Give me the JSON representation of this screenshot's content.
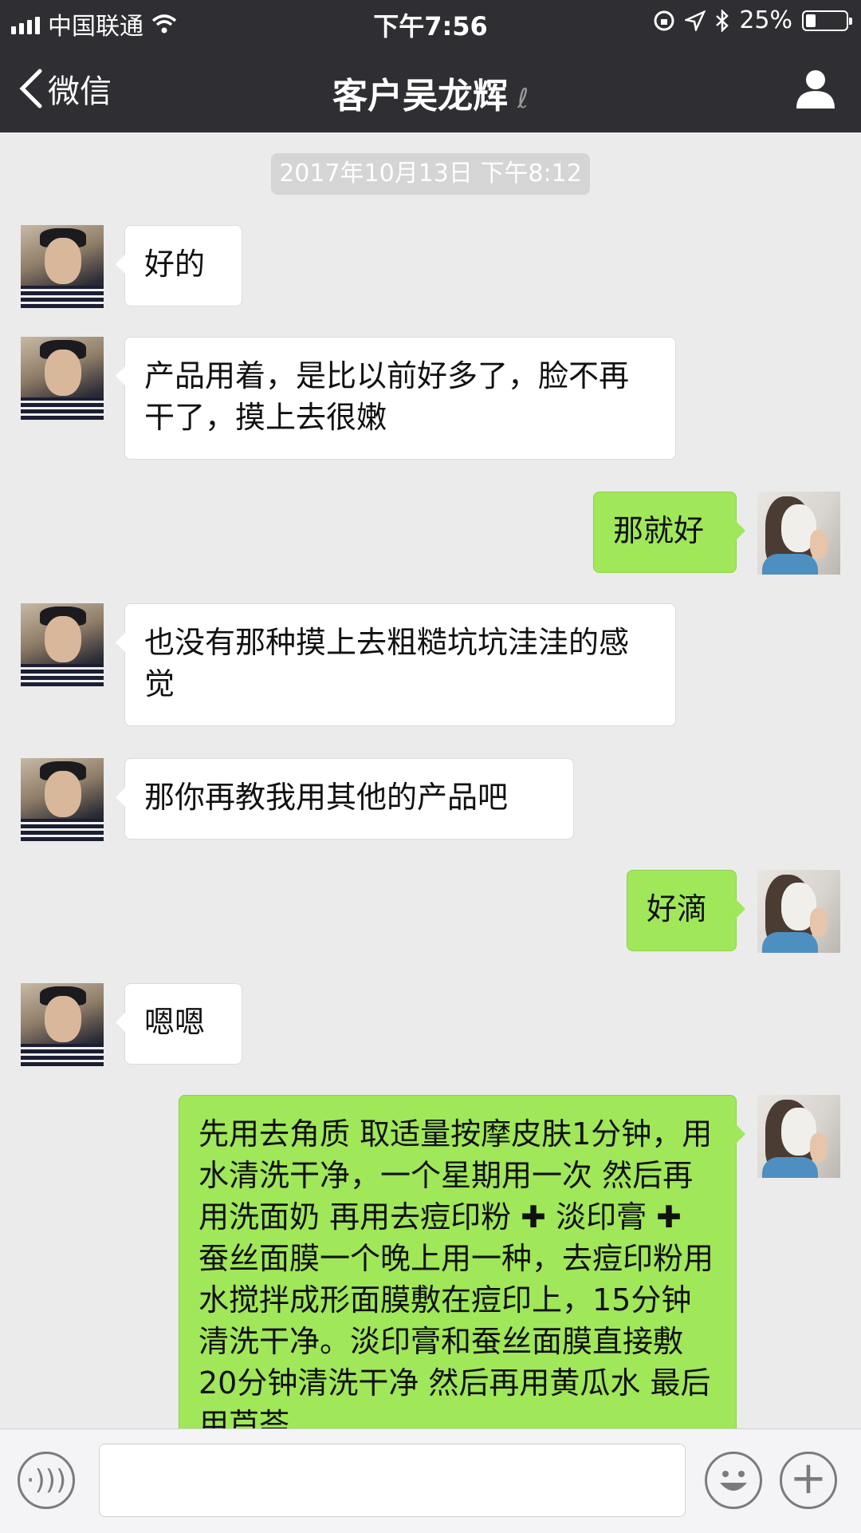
{
  "status_bar": {
    "carrier": "中国联通",
    "time": "下午7:56",
    "battery": "25%",
    "battery_level": 0.25
  },
  "nav": {
    "back_label": "微信",
    "title": "客户吴龙辉",
    "title_icon": "ear-icon",
    "profile_icon": "person-icon"
  },
  "timestamp": "2017年10月13日 下午8:12",
  "messages": [
    {
      "side": "left",
      "text": "好的"
    },
    {
      "side": "left",
      "text": "产品用着，是比以前好多了，脸不再干了，摸上去很嫩"
    },
    {
      "side": "right",
      "text": "那就好"
    },
    {
      "side": "left",
      "text": "也没有那种摸上去粗糙坑坑洼洼的感觉"
    },
    {
      "side": "left",
      "text": "那你再教我用其他的产品吧"
    },
    {
      "side": "right",
      "text": "好滴"
    },
    {
      "side": "left",
      "text": "嗯嗯"
    },
    {
      "side": "right",
      "text": "先用去角质 取适量按摩皮肤1分钟，用水清洗干净，一个星期用一次 然后再用洗面奶 再用去痘印粉 ✚ 淡印膏 ✚ 蚕丝面膜一个晚上用一种，去痘印粉用水搅拌成形面膜敷在痘印上，15分钟清洗干净。淡印膏和蚕丝面膜直接敷20分钟清洗干净 然后再用黄瓜水 最后用芦荟"
    }
  ],
  "colors": {
    "nav_bg": "#2f2f33",
    "chat_bg": "#ebebeb",
    "bubble_self": "#a0e75a",
    "bubble_other": "#ffffff"
  }
}
